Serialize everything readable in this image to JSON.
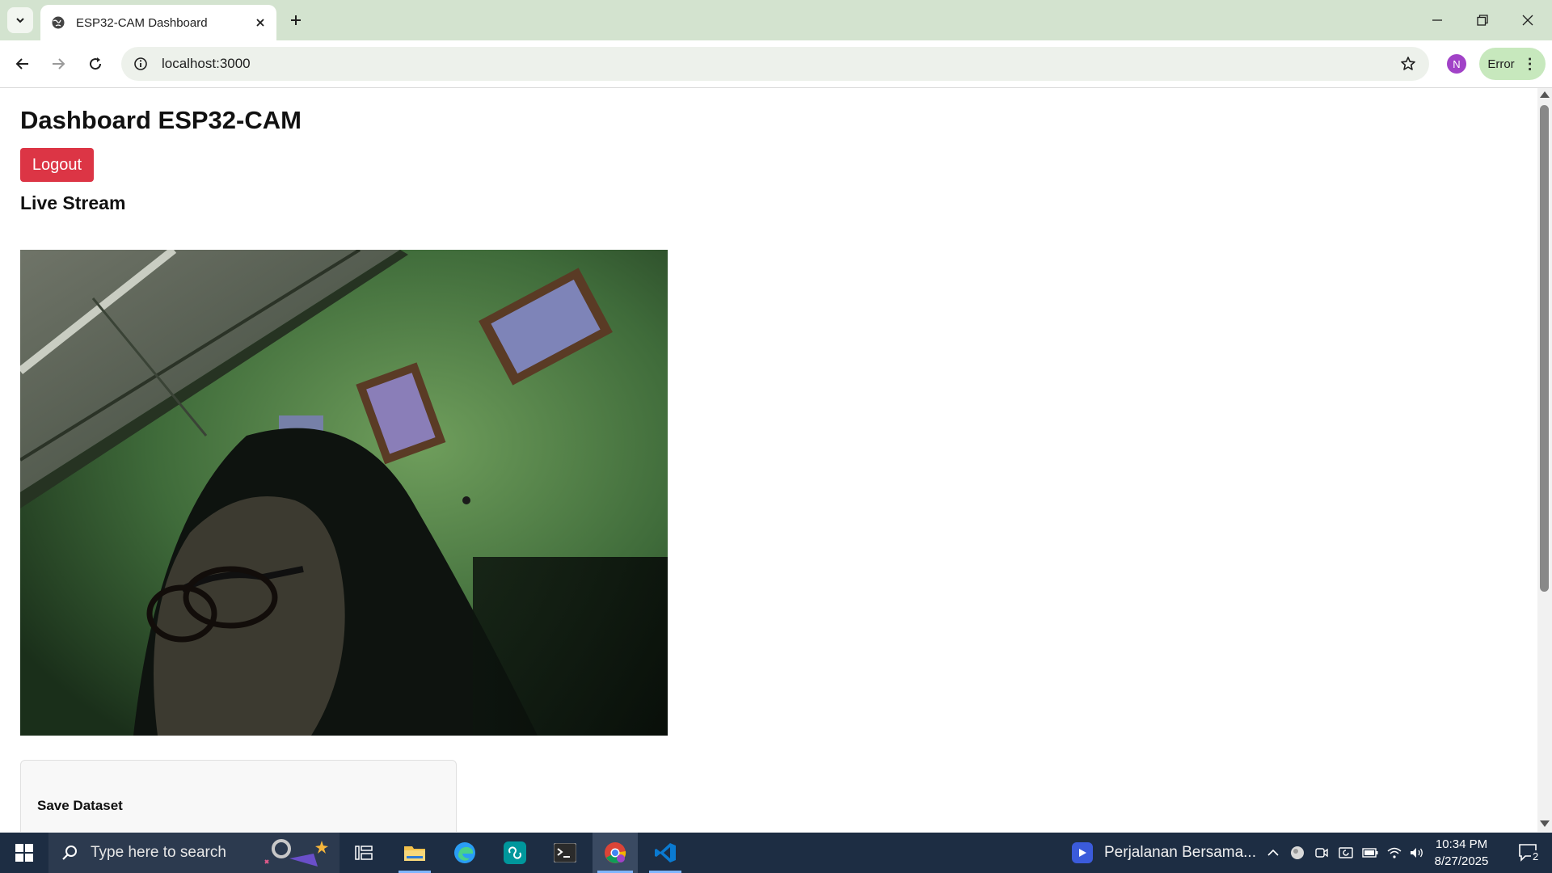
{
  "browser": {
    "tab_title": "ESP32-CAM Dashboard",
    "url": "localhost:3000",
    "profile_initial": "N",
    "error_label": "Error"
  },
  "page": {
    "heading": "Dashboard ESP32-CAM",
    "logout_label": "Logout",
    "stream_heading": "Live Stream",
    "card_heading": "Save Dataset"
  },
  "taskbar": {
    "search_placeholder": "Type here to search",
    "media_title": "Perjalanan Bersama...",
    "time": "10:34 PM",
    "date": "8/27/2025",
    "notification_count": "2"
  },
  "colors": {
    "tabstrip": "#d3e3cf",
    "logout": "#dc3545",
    "taskbar": "#1d2d43",
    "error_pill": "#c7e8bd"
  }
}
